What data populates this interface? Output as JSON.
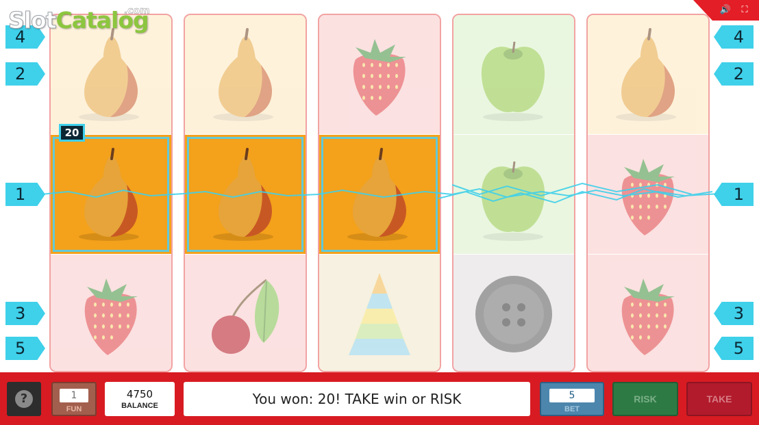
{
  "logo": {
    "text_slot": "Slot",
    "text_catalog": "Catalog",
    "text_com": ".com"
  },
  "corner": {
    "sound_icon": "speaker-icon",
    "fullscreen_icon": "fullscreen-icon"
  },
  "paylines": {
    "left": [
      "4",
      "2",
      "1",
      "3",
      "5"
    ],
    "right": [
      "4",
      "2",
      "1",
      "3",
      "5"
    ]
  },
  "reels": [
    [
      "pear",
      "pear",
      "strawberry"
    ],
    [
      "pear",
      "pear",
      "cherry"
    ],
    [
      "strawberry",
      "pear",
      "pyramid"
    ],
    [
      "apple",
      "apple",
      "button"
    ],
    [
      "pear",
      "strawberry",
      "strawberry"
    ]
  ],
  "win": {
    "amount_badge": "20",
    "winning_row": 1,
    "winning_reels": 3
  },
  "colors": {
    "pear_bg": "#fde7bd",
    "strawberry_bg": "#f9c9c9",
    "apple_bg": "#d9f0c7",
    "button_bg": "#e2dde0",
    "pyramid_bg": "#f0e6c8",
    "win_bg": "#f4a11b",
    "accent": "#3fd0ea",
    "bar": "#d81b22"
  },
  "controls": {
    "help_label": "?",
    "fun_value": "1",
    "fun_label": "FUN",
    "balance_value": "4750",
    "balance_label": "BALANCE",
    "message": "You won: 20! TAKE win or RISK",
    "bet_value": "5",
    "bet_label": "BET",
    "risk_label": "RISK",
    "take_label": "TAKE"
  }
}
